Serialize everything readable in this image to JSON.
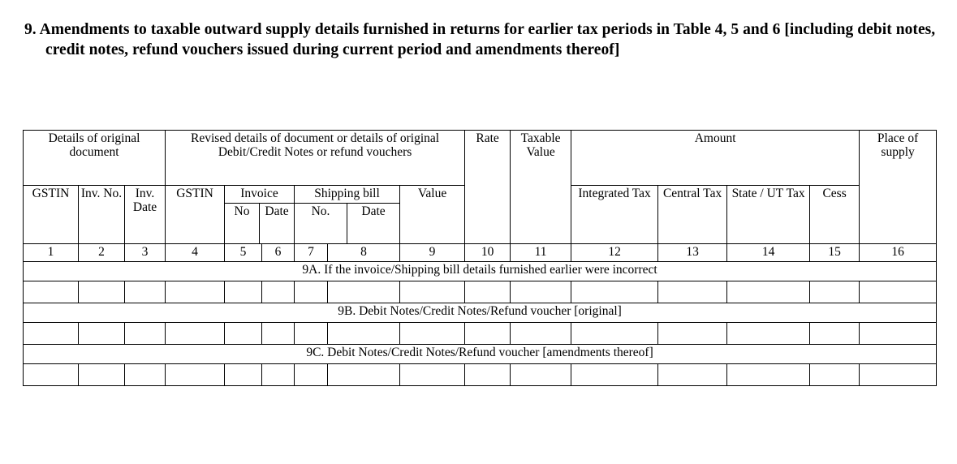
{
  "document": {
    "heading": "9. Amendments to taxable outward supply details furnished in returns for earlier tax periods in Table 4, 5 and 6 [including debit notes, credit notes, refund vouchers issued during current period and amendments thereof]"
  },
  "table": {
    "group_headers": {
      "original_document": "Details of original document",
      "revised_details": "Revised details of document or details of original Debit/Credit Notes or refund vouchers",
      "rate": "Rate",
      "taxable_value": "Taxable Value",
      "amount": "Amount",
      "place_of_supply": "Place of supply"
    },
    "sub_headers": {
      "gstin_original": "GSTIN",
      "inv_no": "Inv. No.",
      "inv_date": "Inv. Date",
      "gstin_revised": "GSTIN",
      "invoice": "Invoice",
      "shipping_bill": "Shipping bill",
      "value": "Value",
      "invoice_no": "No",
      "invoice_date": "Date",
      "shipping_no": "No.",
      "shipping_date": "Date",
      "integrated_tax": "Integrated Tax",
      "central_tax": "Central Tax",
      "state_ut_tax": "State / UT Tax",
      "cess": "Cess"
    },
    "column_numbers": [
      "1",
      "2",
      "3",
      "4",
      "5",
      "6",
      "7",
      "8",
      "9",
      "10",
      "11",
      "12",
      "13",
      "14",
      "15",
      "16"
    ],
    "sections": [
      {
        "id": "9A",
        "label": "9A. If  the invoice/Shipping bill details furnished earlier were incorrect"
      },
      {
        "id": "9B",
        "label": "9B. Debit Notes/Credit Notes/Refund voucher [original]"
      },
      {
        "id": "9C",
        "label": "9C. Debit Notes/Credit Notes/Refund voucher [amendments thereof]"
      }
    ]
  }
}
